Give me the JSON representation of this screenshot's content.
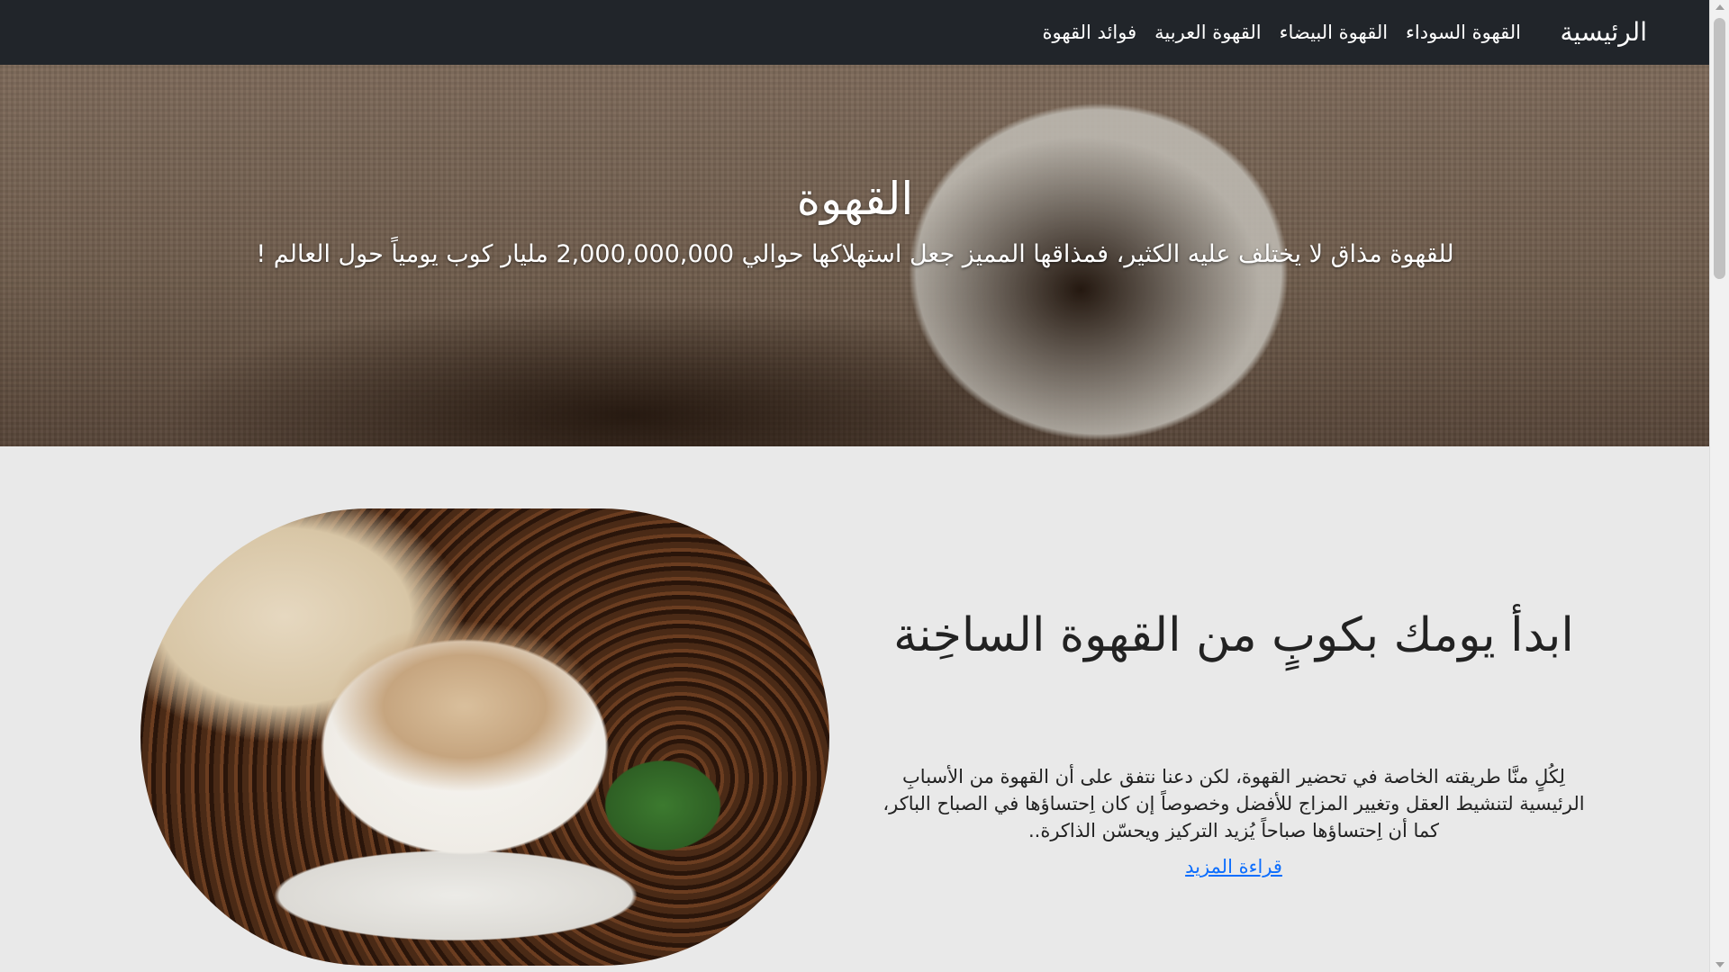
{
  "nav": {
    "brand": "الرئيسية",
    "links": [
      "القهوة السوداء",
      "القهوة البيضاء",
      "القهوة العربية",
      "فوائد القهوة"
    ]
  },
  "hero": {
    "title": "القهوة",
    "text": "للقهوة مذاق لا يختلف عليه الكثير، فمذاقها المميز جعل استهلاكها حوالي 2,000,000,000 مليار كوب يومياً حول العالم !"
  },
  "feature": {
    "title": "ابدأ يومك بكوبٍ من القهوة الساخِنة",
    "text": "لِكُلٍ منَّا طريقته الخاصة في تحضير القهوة، لكن دعنا نتفق على أن القهوة من الأسبابِ الرئيسية لتنشيط العقل وتغيير المزاج للأفضل وخصوصاً إن كان اِحتساؤها في الصباح الباكر، كما أن اِحتساؤها صباحاً يُزيد التركيز ويحسّن الذاكرة..",
    "link": "قراءة المزيد"
  },
  "colors": {
    "navbar_bg": "#21252a",
    "page_bg": "#e9e9e9",
    "link": "#0d6efd"
  }
}
